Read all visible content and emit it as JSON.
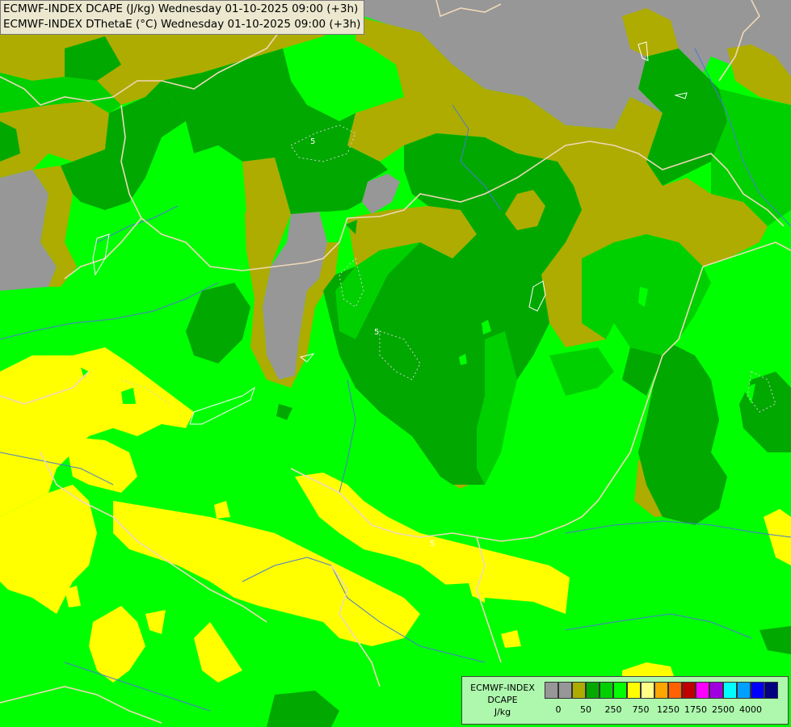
{
  "title": {
    "line1": "ECMWF-INDEX DCAPE (J/kg) Wednesday 01-10-2025 09:00 (+3h)",
    "line2": "ECMWF-INDEX DThetaE (°C) Wednesday 01-10-2025 09:00 (+3h)"
  },
  "contour_labels": [
    "5",
    "5",
    "5"
  ],
  "legend": {
    "title_line1": "ECMWF-INDEX",
    "title_line2": "DCAPE",
    "title_line3": "J/kg",
    "colors": [
      "#979797",
      "#979797",
      "#aeac00",
      "#00a800",
      "#00d000",
      "#00ff00",
      "#ffff00",
      "#ffff88",
      "#ffa500",
      "#ff6000",
      "#c00000",
      "#ff00ff",
      "#a000e0",
      "#00ffff",
      "#00a0ff",
      "#0000ff",
      "#000080"
    ],
    "tick_labels": [
      "0",
      "50",
      "250",
      "750",
      "1250",
      "1750",
      "2500",
      "4000"
    ]
  },
  "map_colors": {
    "bright_green": "#00ff00",
    "green": "#00d000",
    "dark_green": "#00a800",
    "olive": "#aeac00",
    "yellow": "#ffff00",
    "gray": "#979797",
    "border": "#f0d8b8",
    "river": "#4a7ad0"
  }
}
